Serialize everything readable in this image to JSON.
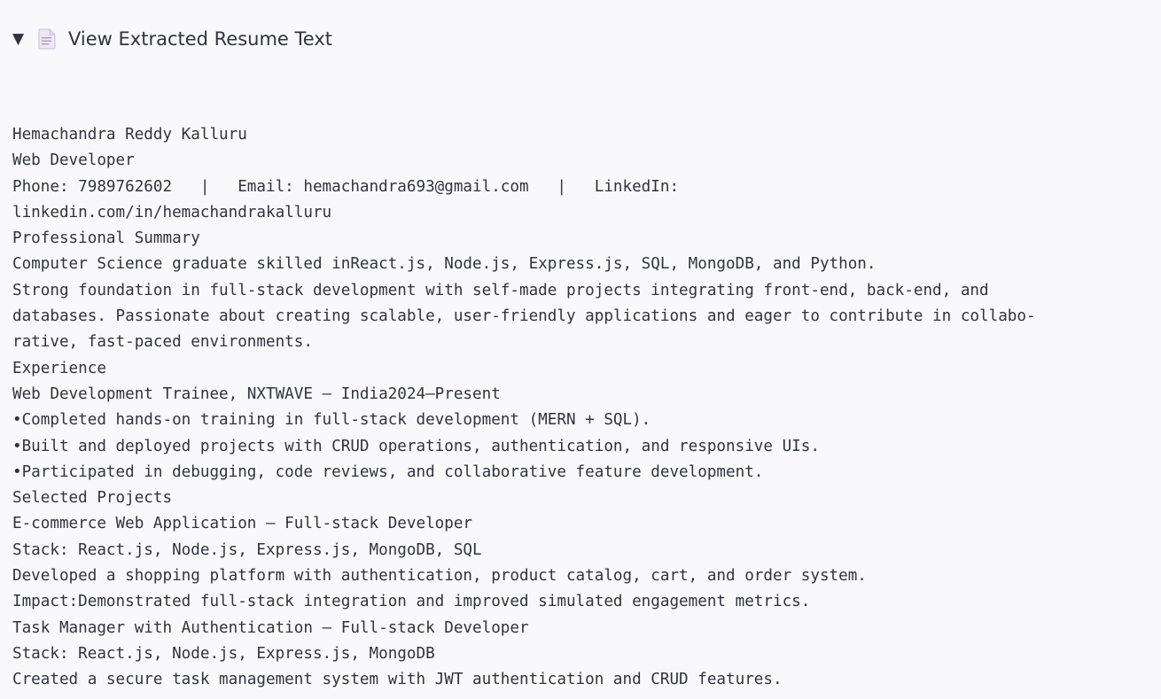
{
  "expander": {
    "arrow": "▼",
    "icon": "document-icon",
    "label": "View Extracted Resume Text"
  },
  "resume_lines": [
    "Hemachandra Reddy Kalluru",
    "Web Developer",
    "Phone: 7989762602   |   Email: hemachandra693@gmail.com   |   LinkedIn:",
    "linkedin.com/in/hemachandrakalluru",
    "Professional Summary",
    "Computer Science graduate skilled inReact.js, Node.js, Express.js, SQL, MongoDB, and Python.",
    "Strong foundation in full-stack development with self-made projects integrating front-end, back-end, and",
    "databases. Passionate about creating scalable, user-friendly applications and eager to contribute in collabo-",
    "rative, fast-paced environments.",
    "Experience",
    "Web Development Trainee, NXTWAVE – India2024–Present",
    "•Completed hands-on training in full-stack development (MERN + SQL).",
    "•Built and deployed projects with CRUD operations, authentication, and responsive UIs.",
    "•Participated in debugging, code reviews, and collaborative feature development.",
    "Selected Projects",
    "E-commerce Web Application – Full-stack Developer",
    "Stack: React.js, Node.js, Express.js, MongoDB, SQL",
    "Developed a shopping platform with authentication, product catalog, cart, and order system.",
    "Impact:Demonstrated full-stack integration and improved simulated engagement metrics.",
    "Task Manager with Authentication – Full-stack Developer",
    "Stack: React.js, Node.js, Express.js, MongoDB",
    "Created a secure task management system with JWT authentication and CRUD features."
  ]
}
